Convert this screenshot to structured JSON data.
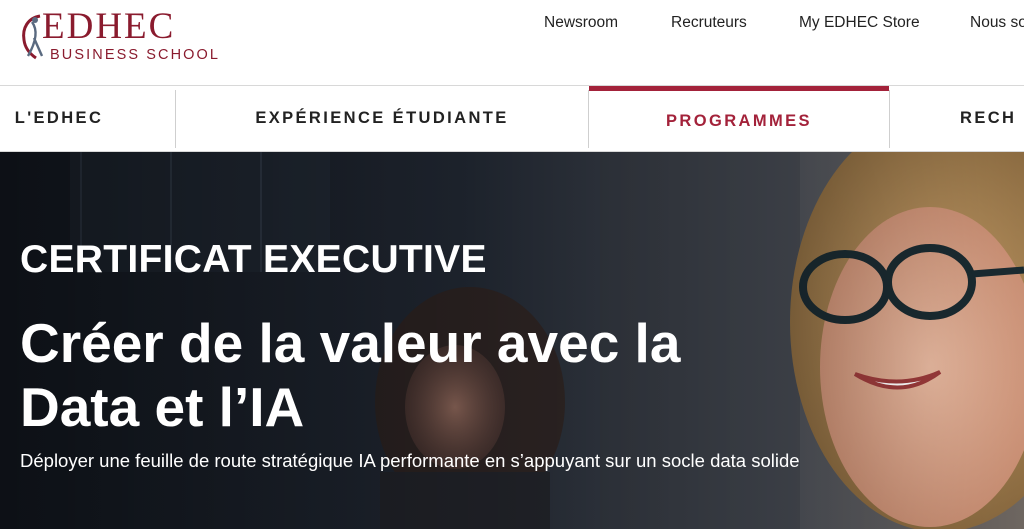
{
  "brand": {
    "name": "EDHEC",
    "subtitle": "BUSINESS SCHOOL",
    "color": "#8a1b2e"
  },
  "utility_nav": [
    {
      "label": "Newsroom"
    },
    {
      "label": "Recruteurs"
    },
    {
      "label": "My EDHEC Store"
    },
    {
      "label": "Nous so"
    }
  ],
  "main_nav": [
    {
      "label": "L'EDHEC",
      "active": false
    },
    {
      "label": "EXPÉRIENCE ÉTUDIANTE",
      "active": false
    },
    {
      "label": "PROGRAMMES",
      "active": true
    },
    {
      "label": "RECH",
      "active": false
    }
  ],
  "hero": {
    "kicker": "CERTIFICAT EXECUTIVE",
    "title": "Créer de la valeur avec la Data et l’IA",
    "description": "Déployer une feuille de route stratégique IA performante en s’appuyant sur un socle data solide"
  },
  "colors": {
    "accent": "#a3223a",
    "hero_overlay": "#1e2733",
    "text_dark": "#222222"
  }
}
